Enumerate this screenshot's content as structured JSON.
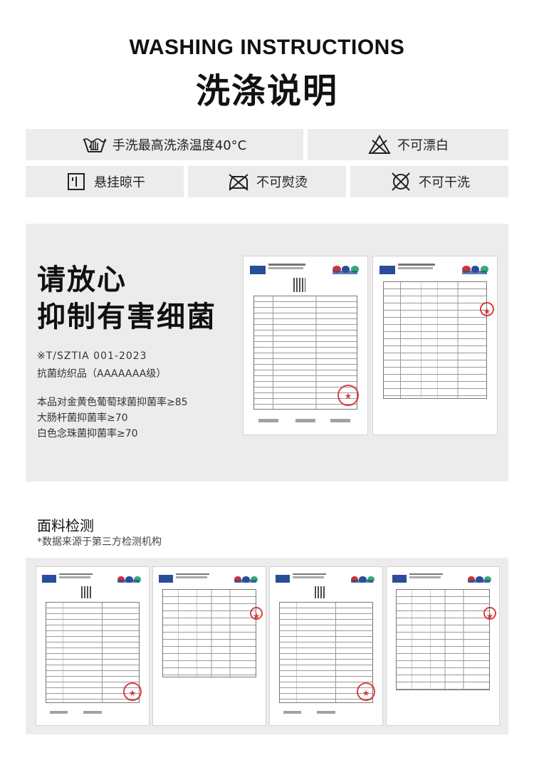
{
  "header": {
    "title_en": "WASHING INSTRUCTIONS",
    "title_cn": "洗涤说明"
  },
  "care": [
    {
      "icon": "hand-wash-icon",
      "label": "手洗最高洗涤温度40°C"
    },
    {
      "icon": "no-bleach-icon",
      "label": "不可漂白"
    },
    {
      "icon": "hang-dry-icon",
      "label": "悬挂晾干"
    },
    {
      "icon": "no-iron-icon",
      "label": "不可熨烫"
    },
    {
      "icon": "no-dry-clean-icon",
      "label": "不可干洗"
    }
  ],
  "antibacterial": {
    "headline_1": "请放心",
    "headline_2": "抑制有害细菌",
    "standard": "※T/SZTIA 001-2023",
    "grade": "抗菌纺织品（AAAAAAA级）",
    "rates": [
      "本品对金黄色葡萄球菌抑菌率≥85",
      "大肠杆菌抑菌率≥70",
      "白色念珠菌抑菌率≥70"
    ]
  },
  "fabric": {
    "title": "面料检测",
    "note": "*数据来源于第三方检测机构"
  },
  "colors": {
    "panel": "#ececec",
    "seal_red": "#d42020",
    "logo_blue": "#2a4d9b"
  }
}
